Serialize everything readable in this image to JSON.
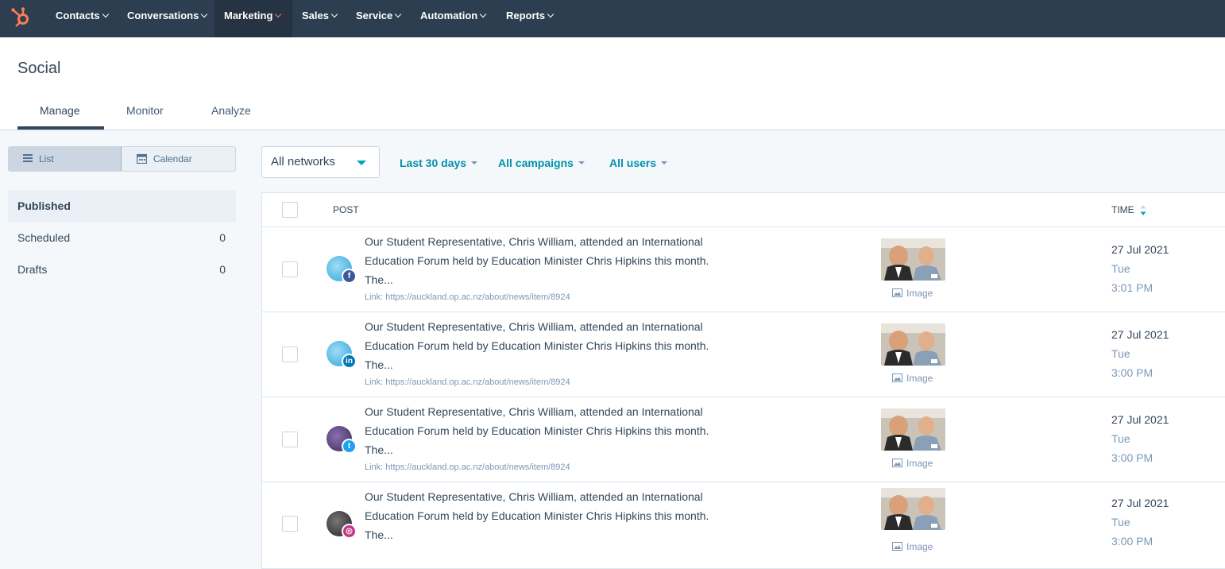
{
  "nav": {
    "items": [
      {
        "label": "Contacts"
      },
      {
        "label": "Conversations"
      },
      {
        "label": "Marketing"
      },
      {
        "label": "Sales"
      },
      {
        "label": "Service"
      },
      {
        "label": "Automation"
      },
      {
        "label": "Reports"
      }
    ],
    "active": "Marketing",
    "logo_icon": "hubspot-sprocket-icon",
    "brand_color": "#ff7a59"
  },
  "page": {
    "title": "Social",
    "tabs": [
      {
        "label": "Manage"
      },
      {
        "label": "Monitor"
      },
      {
        "label": "Analyze"
      }
    ],
    "active_tab": "Manage"
  },
  "view_toggle": {
    "list_label": "List",
    "calendar_label": "Calendar",
    "active": "List"
  },
  "sidebar": {
    "items": [
      {
        "label": "Published",
        "count": ""
      },
      {
        "label": "Scheduled",
        "count": "0"
      },
      {
        "label": "Drafts",
        "count": "0"
      }
    ],
    "active": "Published"
  },
  "filters": {
    "network": "All networks",
    "date_range": "Last 30 days",
    "campaigns": "All campaigns",
    "users": "All users"
  },
  "table": {
    "headers": {
      "post": "POST",
      "time": "TIME"
    },
    "rows": [
      {
        "network": "facebook",
        "network_glyph": "f",
        "network_color": "#3b5998",
        "text": "Our Student Representative, Chris William, attended an International Education Forum held by Education Minister Chris Hipkins this month. The...",
        "link": "Link: https://auckland.op.ac.nz/about/news/item/8924",
        "media_label": "Image",
        "date": "27 Jul 2021",
        "day": "Tue",
        "time": "3:01 PM"
      },
      {
        "network": "linkedin",
        "network_glyph": "in",
        "network_color": "#0077b5",
        "text": "Our Student Representative, Chris William, attended an International Education Forum held by Education Minister Chris Hipkins this month. The...",
        "link": "Link: https://auckland.op.ac.nz/about/news/item/8924",
        "media_label": "Image",
        "date": "27 Jul 2021",
        "day": "Tue",
        "time": "3:00 PM"
      },
      {
        "network": "twitter",
        "network_glyph": "t",
        "network_color": "#1da1f2",
        "text": "Our Student Representative, Chris William, attended an International Education Forum held by Education Minister Chris Hipkins this month. The...",
        "link": "Link: https://auckland.op.ac.nz/about/news/item/8924",
        "media_label": "Image",
        "date": "27 Jul 2021",
        "day": "Tue",
        "time": "3:00 PM"
      },
      {
        "network": "instagram",
        "network_glyph": "◎",
        "network_color": "#c13584",
        "text": "Our Student Representative, Chris William, attended an International Education Forum held by Education Minister Chris Hipkins this month. The...",
        "link": "",
        "media_label": "Image",
        "date": "27 Jul 2021",
        "day": "Tue",
        "time": "3:00 PM"
      }
    ]
  }
}
